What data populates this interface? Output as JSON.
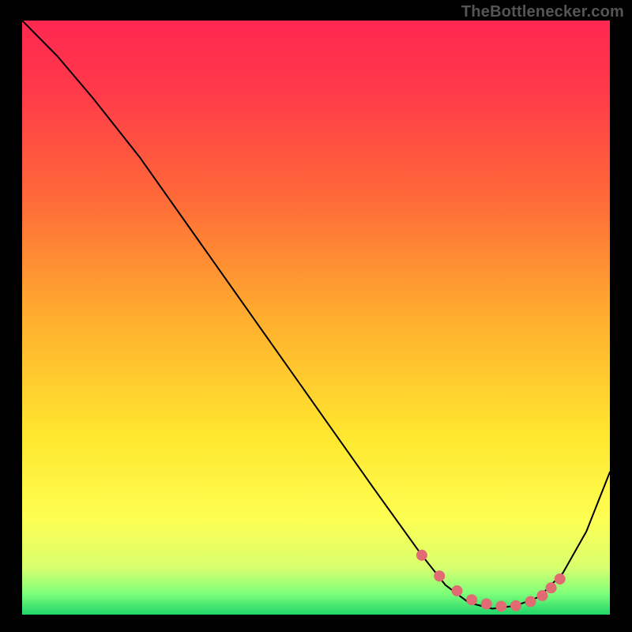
{
  "watermark": "TheBottlenecker.com",
  "chart_data": {
    "type": "line",
    "title": "",
    "xlabel": "",
    "ylabel": "",
    "xlim": [
      0,
      100
    ],
    "ylim": [
      0,
      100
    ],
    "grid": false,
    "series": [
      {
        "name": "main_curve",
        "color": "#000000",
        "x": [
          0,
          6,
          12,
          20,
          30,
          40,
          50,
          60,
          68,
          72,
          76,
          80,
          84,
          88,
          92,
          96,
          100
        ],
        "values": [
          100,
          94,
          87,
          77,
          63,
          49,
          35,
          21,
          10,
          5,
          2,
          1,
          1.5,
          3,
          7,
          14,
          24
        ]
      },
      {
        "name": "highlight_dots",
        "color": "#e06b73",
        "x": [
          68,
          71,
          74,
          76.5,
          79,
          81.5,
          84,
          86.5,
          88.5,
          90,
          91.5
        ],
        "values": [
          10,
          6.5,
          4,
          2.5,
          1.8,
          1.4,
          1.5,
          2.2,
          3.2,
          4.5,
          6.0
        ]
      }
    ],
    "background_gradient": {
      "stops": [
        {
          "offset": 0.0,
          "color": "#ff2850"
        },
        {
          "offset": 0.12,
          "color": "#ff3a4a"
        },
        {
          "offset": 0.3,
          "color": "#ff6a38"
        },
        {
          "offset": 0.5,
          "color": "#ffae2e"
        },
        {
          "offset": 0.7,
          "color": "#ffe72e"
        },
        {
          "offset": 0.84,
          "color": "#fdff52"
        },
        {
          "offset": 0.92,
          "color": "#d9ff6e"
        },
        {
          "offset": 0.965,
          "color": "#7dff7a"
        },
        {
          "offset": 1.0,
          "color": "#1fd56a"
        }
      ]
    }
  }
}
